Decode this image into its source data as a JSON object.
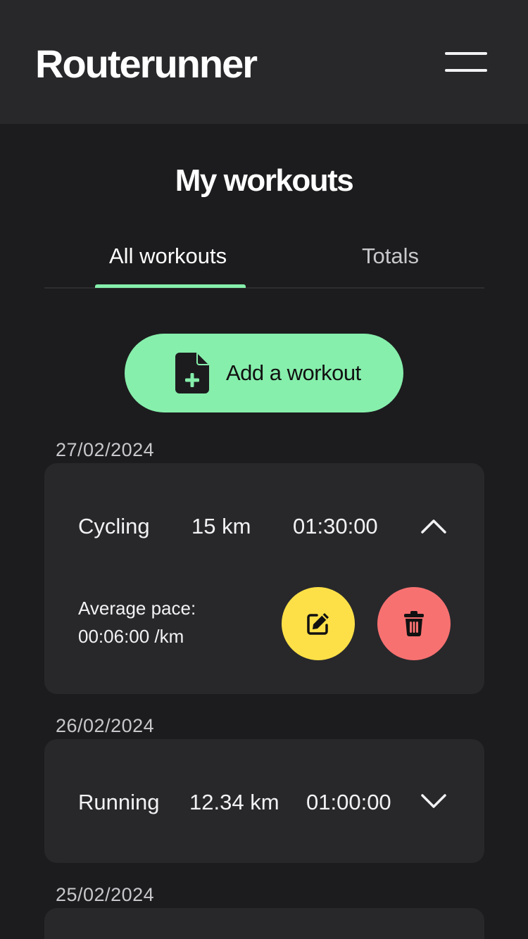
{
  "header": {
    "brand": "Routerunner",
    "menu_icon": "hamburger-menu-icon"
  },
  "page": {
    "title": "My workouts"
  },
  "tabs": [
    {
      "label": "All workouts",
      "active": true
    },
    {
      "label": "Totals",
      "active": false
    }
  ],
  "add_button": {
    "label": "Add a workout",
    "icon": "file-plus-icon"
  },
  "colors": {
    "accent": "#86efac",
    "edit": "#fde047",
    "delete": "#f87171",
    "background": "#1c1c1e",
    "surface": "#28282b"
  },
  "workouts": [
    {
      "date": "27/02/2024",
      "type": "Cycling",
      "distance": "15 km",
      "duration": "01:30:00",
      "expanded": true,
      "chevron_icon": "chevron-up-icon",
      "pace_label": "Average pace:",
      "pace_value": "00:06:00 /km",
      "edit_icon": "edit-icon",
      "delete_icon": "trash-icon"
    },
    {
      "date": "26/02/2024",
      "type": "Running",
      "distance": "12.34 km",
      "duration": "01:00:00",
      "expanded": false,
      "chevron_icon": "chevron-down-icon"
    },
    {
      "date": "25/02/2024"
    }
  ]
}
